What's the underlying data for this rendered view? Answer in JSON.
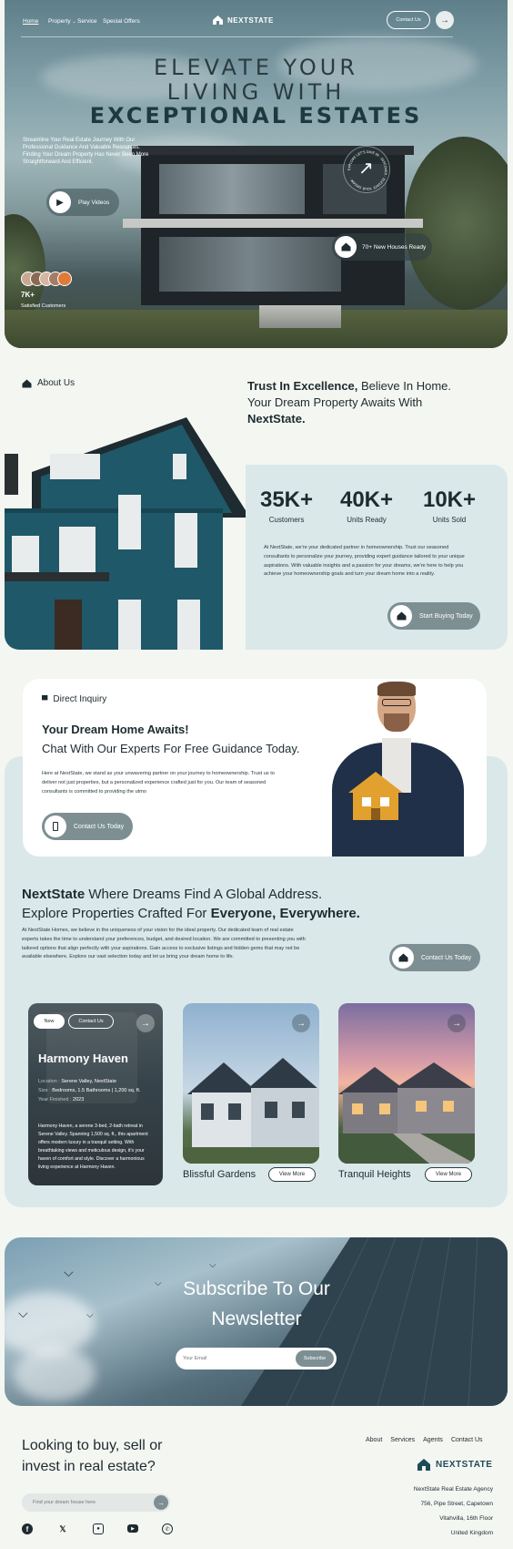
{
  "nav": {
    "items": [
      "Home",
      "Property",
      "Service",
      "Special Offers"
    ],
    "brand": "NEXTSTATE",
    "contact": "Contact Us"
  },
  "hero": {
    "line1": "ELEVATE YOUR",
    "line2": "LIVING WITH",
    "line3": "EXCEPTIONAL ESTATES",
    "sub": "Streamline Your Real Estate Journey With Our Professional Guidance And Valuable Resources. Finding Your Dream Property Has Never Been More Straightforward And Efficient.",
    "play": "Play Videos",
    "badge": "70+ New Houses Ready",
    "customers_count": "7K+",
    "customers_label": "Satisfied Customers",
    "round_text": "EXPLORE LET'S DIVE IN · DISCOVER · ELEVATE YOUR DREAM ·"
  },
  "about": {
    "label": "About Us",
    "h_bold1": "Trust In Excellence,",
    "h_reg1": " Believe In Home.",
    "h_reg2": "Your Dream Property Awaits With",
    "h_bold2": "NextState.",
    "stats": [
      {
        "n": "35K+",
        "l": "Customers"
      },
      {
        "n": "40K+",
        "l": "Units Ready"
      },
      {
        "n": "10K+",
        "l": "Units Sold"
      }
    ],
    "para": "At NextState, we're your dedicated partner in homeownership. Trust our seasoned consultants to personalize your journey, providing expert guidance tailored to your unique aspirations. With valuable insights and a passion for your dreams, we're here to help you achieve your homeownership goals and turn your dream home into a reality.",
    "btn": "Start Buying Today"
  },
  "inquiry": {
    "label": "Direct Inquiry",
    "h1": "Your Dream Home Awaits!",
    "h2": "Chat With Our Experts For Free Guidance Today.",
    "para": "Here at NextState, we stand as your unwavering partner on your journey to homeownership. Trust us to deliver not just properties, but a personalized experience crafted just for you. Our team of seasoned consultants is committed to providing the utmo",
    "btn": "Contact Us Today"
  },
  "global": {
    "b1": "NextState",
    "r1": " Where Dreams Find A Global Address.",
    "r2": "Explore Properties Crafted For ",
    "b2": "Everyone, Everywhere.",
    "para": "At NextState Homes, we believe in the uniqueness of your vision for the ideal property. Our dedicated team of real estate experts takes the time to understand your preferences, budget, and desired location. We are committed to presenting you with tailored options that align perfectly with your aspirations. Gain access to exclusive listings and hidden gems that may not be available elsewhere. Explore our vast selection today and let us bring your dream home to life.",
    "btn": "Contact Us Today"
  },
  "featured": {
    "tag_new": "New",
    "tag_contact": "Contact Us",
    "name": "Harmony Haven",
    "location_label": "Location :",
    "location": "Serene Valley, NextState",
    "size_label": "Size :",
    "size": "Bedrooms, 1.5 Bathrooms | 1,200 sq. ft.",
    "year_label": "Year Finished :",
    "year": "2023",
    "desc": "Harmony Haven, a serene 3-bed, 2-bath retreat in Serene Valley. Spanning 1,500 sq. ft., this apartment offers modern luxury in a tranquil setting. With breathtaking views and meticulous design, it's your haven of comfort and style. Discover a harmonious living experience at Harmony Haven."
  },
  "props": [
    {
      "name": "Blissful Gardens",
      "btn": "View More"
    },
    {
      "name": "Tranquil Heights",
      "btn": "View More"
    }
  ],
  "newsletter": {
    "h1": "Subscribe To Our",
    "h2": "Newsletter",
    "placeholder": "Your Email",
    "btn": "Subscribe"
  },
  "footer": {
    "h1": "Looking to buy, sell or",
    "h2": "invest in real estate?",
    "search_placeholder": "Find your dream house here",
    "links": [
      "About",
      "Services",
      "Agents",
      "Contact Us"
    ],
    "brand": "NEXTSTATE",
    "addr": [
      "NextState Real Estate Agency",
      "756, Pipe Street, Capetown",
      "Vitahvilla, 16th Floor",
      "United Kingdom"
    ]
  },
  "colors": {
    "accent": "#1e4a55",
    "panel": "#dbe8ea",
    "button": "#7d8f93"
  }
}
